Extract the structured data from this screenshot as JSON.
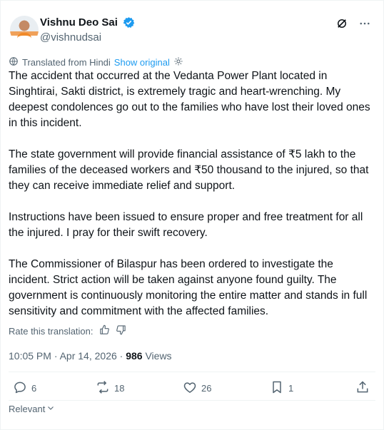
{
  "author": {
    "display_name": "Vishnu Deo Sai",
    "handle": "@vishnudsai"
  },
  "translation": {
    "label": "Translated from Hindi",
    "show_original": "Show original",
    "rate_label": "Rate this translation:"
  },
  "paragraphs": [
    "The accident that occurred at the Vedanta Power Plant located in Singhtirai, Sakti district, is extremely tragic and heart-wrenching. My deepest condolences go out to the families who have lost their loved ones in this incident.",
    "The state government will provide financial assistance of ₹5 lakh to the families of the deceased workers and ₹50 thousand to the injured, so that they can receive immediate relief and support.",
    "Instructions have been issued to ensure proper and free treatment for all the injured. I pray for their swift recovery.",
    "The Commissioner of Bilaspur has been ordered to investigate the incident. Strict action will be taken against anyone found guilty. The government is continuously monitoring the entire matter and stands in full sensitivity and commitment with the affected families."
  ],
  "meta": {
    "timestamp": "10:05 PM · Apr 14, 2026 · ",
    "views_count": "986",
    "views_label": " Views"
  },
  "actions": {
    "replies": "6",
    "reposts": "18",
    "likes": "26",
    "bookmarks": "1"
  },
  "sort_label": "Relevant",
  "colors": {
    "accent": "#1d9bf0",
    "muted": "#536471",
    "text": "#0f1419"
  },
  "icons": [
    "verified-badge-icon",
    "grok-icon",
    "more-icon",
    "globe-icon",
    "settings-icon",
    "thumbs-up-icon",
    "thumbs-down-icon",
    "reply-icon",
    "repost-icon",
    "like-icon",
    "bookmark-icon",
    "share-icon",
    "chevron-down-icon"
  ]
}
